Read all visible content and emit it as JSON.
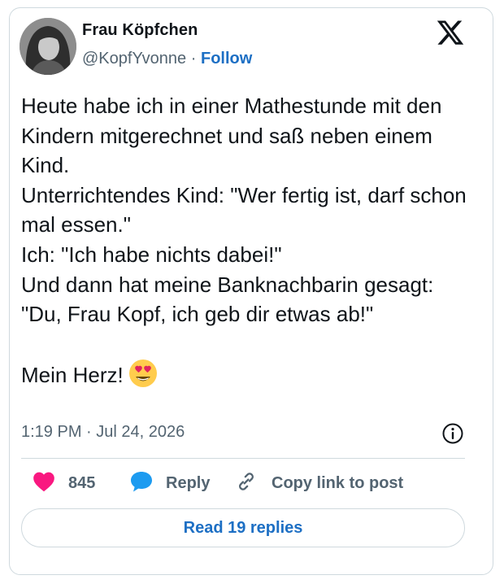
{
  "author": {
    "name": "Frau Köpfchen",
    "handle": "@KopfYvonne",
    "separator": "·",
    "follow_label": "Follow"
  },
  "tweet": {
    "text": "Heute habe ich in einer Mathestunde mit den Kindern mitgerechnet und saß neben einem Kind.\nUnterrichtendes Kind: \"Wer fertig ist, darf schon mal essen.\"\nIch: \"Ich habe nichts dabei!\"\nUnd dann hat meine Banknachbarin gesagt:\n\"Du, Frau Kopf, ich geb dir etwas ab!\"\n\nMein Herz!",
    "emoji": "heart-eyes-emoji",
    "timestamp": "1:19 PM · Jul 24, 2026"
  },
  "actions": {
    "like_count": "845",
    "reply_label": "Reply",
    "copy_link_label": "Copy link to post"
  },
  "replies_button": {
    "label": "Read 19 replies"
  },
  "colors": {
    "accent": "#1d6fc4",
    "like": "#f91880",
    "secondary_text": "#536471",
    "border": "#cfd9de"
  },
  "icons": [
    "x-logo-icon",
    "info-icon",
    "heart-icon",
    "reply-bubble-icon",
    "link-icon"
  ]
}
